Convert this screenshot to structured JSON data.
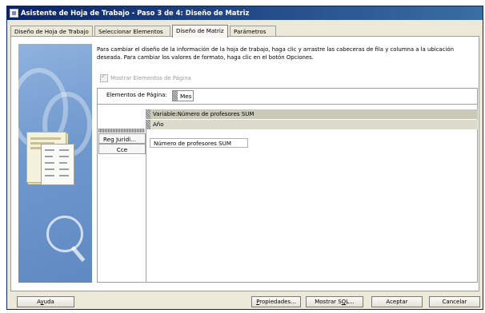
{
  "window": {
    "title": "Asistente de Hoja de Trabajo - Paso 3 de 4: Diseño de Matriz",
    "app_icon": "wizard-icon"
  },
  "tabs": [
    {
      "label": "Diseño de Hoja de Trabajo",
      "active": false
    },
    {
      "label": "Seleccionar Elementos",
      "active": false
    },
    {
      "label": "Diseño de Matriz",
      "active": true
    },
    {
      "label": "Parámetros",
      "active": false
    }
  ],
  "instructions": "Para cambiar el diseño de la información de la hoja de trabajo, haga clic y arrastre las cabeceras de fila y columna a la ubicación deseada. Para cambiar los valores de formato, haga clic en el botón Opciones.",
  "show_page_items": {
    "label": "Mostrar Elementos de Página",
    "checked": true,
    "enabled": false
  },
  "page_items": {
    "label": "Elementos de Página:",
    "item": "Mes"
  },
  "column_headers": [
    "Variable:Número de profesores SUM",
    "Año"
  ],
  "row_headers": [
    "Reg Juridi...",
    "Cce"
  ],
  "data_cell": "Número de profesores SUM",
  "buttons": {
    "help": {
      "pre": "A",
      "accel": "y",
      "post": "uda"
    },
    "properties": {
      "pre": "",
      "accel": "P",
      "post": "ropiedades..."
    },
    "show_sql": {
      "pre": "Mostrar S",
      "accel": "Q",
      "post": "L..."
    },
    "accept": "Aceptar",
    "cancel": "Cancelar"
  },
  "colors": {
    "title_bar": "#0a246a",
    "header_band": "#c9c9b8",
    "dialog_bg": "#ece9d8"
  }
}
